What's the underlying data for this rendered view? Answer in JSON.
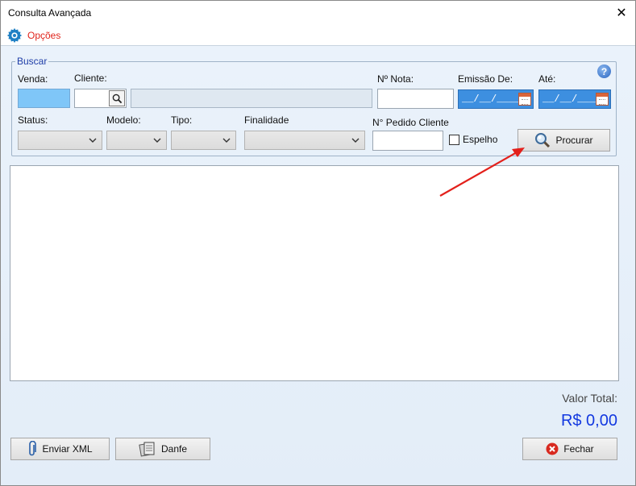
{
  "window": {
    "title": "Consulta Avançada",
    "close_glyph": "✕"
  },
  "menu": {
    "options_label": "Opções",
    "options_icon": "gear-icon"
  },
  "search_group": {
    "legend": "Buscar",
    "venda_label": "Venda:",
    "cliente_label": "Cliente:",
    "nota_label": "Nº Nota:",
    "emissao_label": "Emissão De:",
    "ate_label": "Até:",
    "emissao_value": "__/__/____",
    "ate_value": "__/__/____",
    "status_label": "Status:",
    "modelo_label": "Modelo:",
    "tipo_label": "Tipo:",
    "finalidade_label": "Finalidade",
    "pedido_label": "N° Pedido Cliente",
    "espelho_label": "Espelho",
    "search_button": "Procurar",
    "help_glyph": "?"
  },
  "totals": {
    "label": "Valor Total:",
    "value": "R$ 0,00"
  },
  "footer": {
    "enviar_xml": "Enviar XML",
    "danfe": "Danfe",
    "fechar": "Fechar"
  },
  "colors": {
    "accent_red": "#e0241b",
    "total_blue": "#1238e0",
    "field_blue": "#7fc6f8",
    "date_blue": "#3d8fe0"
  }
}
